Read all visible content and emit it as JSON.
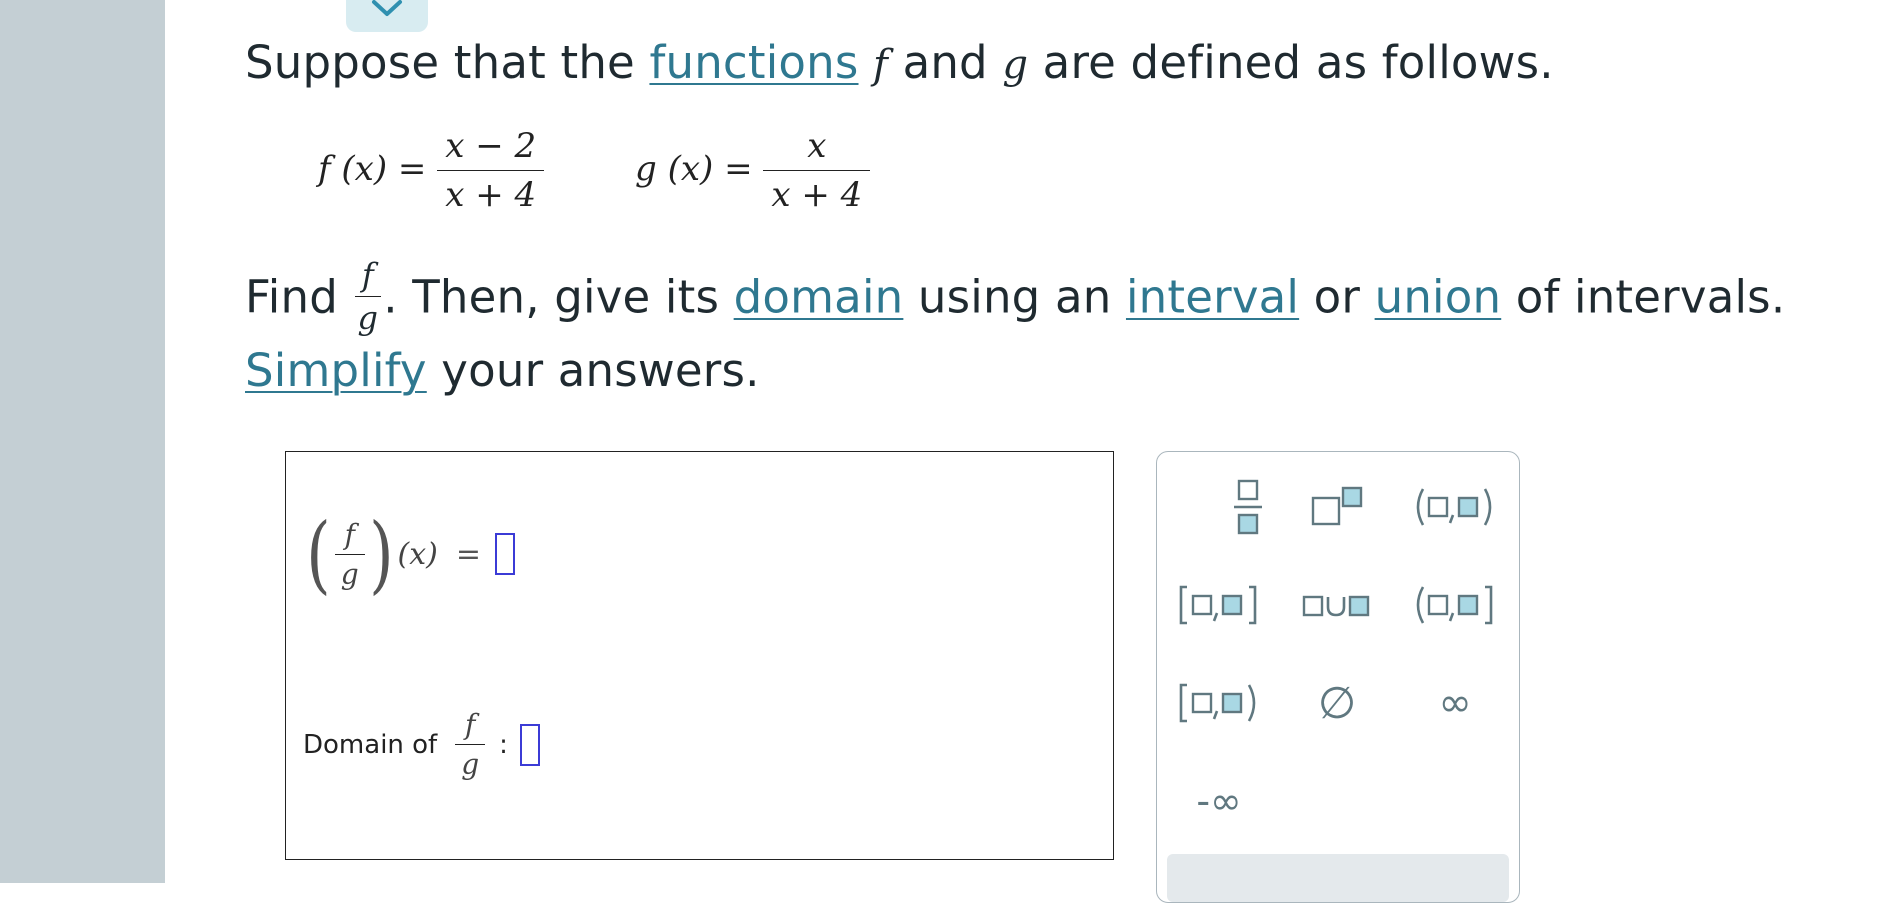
{
  "problem": {
    "intro_prefix": "Suppose that the",
    "link_functions": "functions",
    "var_f": "f",
    "word_and": "and",
    "var_g": "g",
    "intro_suffix": "are defined as follows.",
    "f_lhs": "f (x) =",
    "f_num": "x − 2",
    "f_den": "x + 4",
    "g_lhs": "g (x) =",
    "g_num": "x",
    "g_den": "x + 4",
    "find_word": "Find",
    "find_num": "f",
    "find_den": "g",
    "find_rest_a": ". Then, give its",
    "link_domain": "domain",
    "find_rest_b": "using an",
    "link_interval": "interval",
    "word_or": "or",
    "link_union": "union",
    "find_rest_c": "of intervals.",
    "link_simplify": "Simplify",
    "simplify_rest": "your answers."
  },
  "answer": {
    "quotient_num": "f",
    "quotient_den": "g",
    "quotient_arg": "(x)",
    "equals": "=",
    "domain_label": "Domain of",
    "domain_num": "f",
    "domain_den": "g",
    "colon": ":"
  },
  "palette": {
    "buttons": [
      "fraction",
      "exponent",
      "open-interval",
      "closed-interval",
      "union",
      "left-open-interval",
      "left-closed-interval",
      "empty-set",
      "infinity",
      "negative-infinity"
    ],
    "empty_set_symbol": "∅",
    "infinity_symbol": "∞",
    "neg_infinity_symbol": "-∞",
    "accent_color": "#a9d8e4",
    "border_color": "#607880"
  },
  "colors": {
    "link": "#2f7890",
    "input_border": "#3b3bd6",
    "left_rail": "#c4cfd4"
  }
}
